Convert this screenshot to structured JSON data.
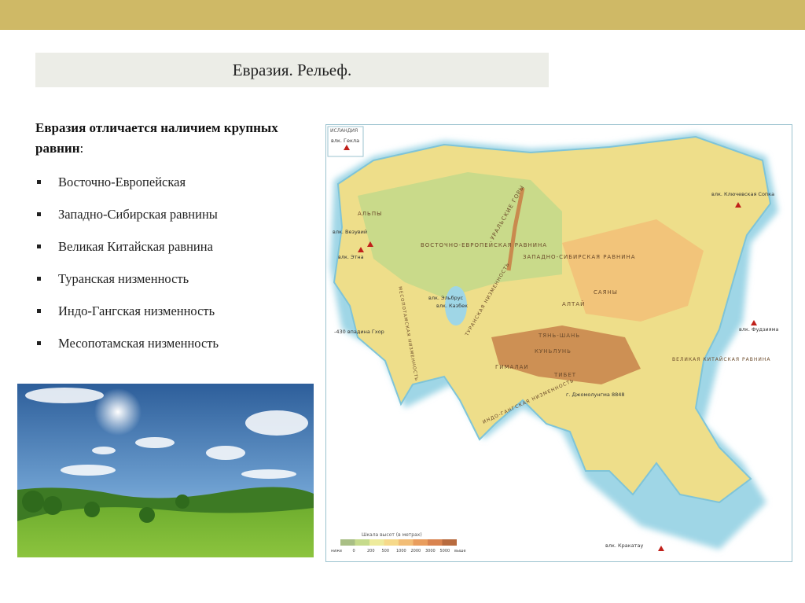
{
  "slide": {
    "title": "Евразия. Рельеф.",
    "intro_text": "Евразия отличается наличием крупных равнин",
    "intro_colon": ":",
    "plains": [
      "Восточно-Европейская",
      "Западно-Сибирская равнины",
      "Великая Китайская равнина",
      "Туранская низменность",
      "Индо-Гангская низменность",
      "Месопотамская низменность"
    ]
  },
  "map": {
    "inset_label": "ИСЛАНДИЯ",
    "labels": {
      "hekla": "влк. Гекла",
      "vesuvius": "влк. Везувий",
      "etna": "влк. Этна",
      "alps": "АЛЬПЫ",
      "east_european": "ВОСТОЧНО-ЕВРОПЕЙСКАЯ РАВНИНА",
      "west_siberian": "ЗАПАДНО-СИБИРСКАЯ РАВНИНА",
      "urals": "УРАЛЬСКИЕ ГОРЫ",
      "elbrus": "влк. Эльбрус",
      "kazbek": "влк. Казбек",
      "ghor": "-430 впадина Гхор",
      "mesopotamian": "МЕСОПОТАМСКАЯ НИЗМЕННОСТЬ",
      "turan": "ТУРАНСКАЯ НИЗМЕННОСТЬ",
      "altai": "АЛТАЙ",
      "sayan": "САЯНЫ",
      "tianshan": "ТЯНЬ-ШАНЬ",
      "kunlun": "КУНЬЛУНЬ",
      "tibet": "ТИБЕТ",
      "himalaya": "ГИМАЛАИ",
      "everest": "г. Джомолунгма 8848",
      "indo_gangetic": "ИНДО-ГАНГСКАЯ НИЗМЕННОСТЬ",
      "great_chinese": "ВЕЛИКАЯ КИТАЙСКАЯ РАВНИНА",
      "klyuchevskaya": "влк. Ключевская Сопка",
      "fuji": "влк. Фудзияма",
      "krakatau": "влк. Кракатау"
    },
    "legend": {
      "title": "Шкала высот (в метрах)",
      "ticks": [
        "ниже",
        "0",
        "200",
        "500",
        "1000",
        "2000",
        "3000",
        "5000",
        "выше"
      ],
      "colors": [
        "#a9bf85",
        "#c6db8c",
        "#eeeb9c",
        "#f6d98a",
        "#f2bd76",
        "#e99d5d",
        "#d9834f",
        "#b86b3f"
      ]
    }
  }
}
